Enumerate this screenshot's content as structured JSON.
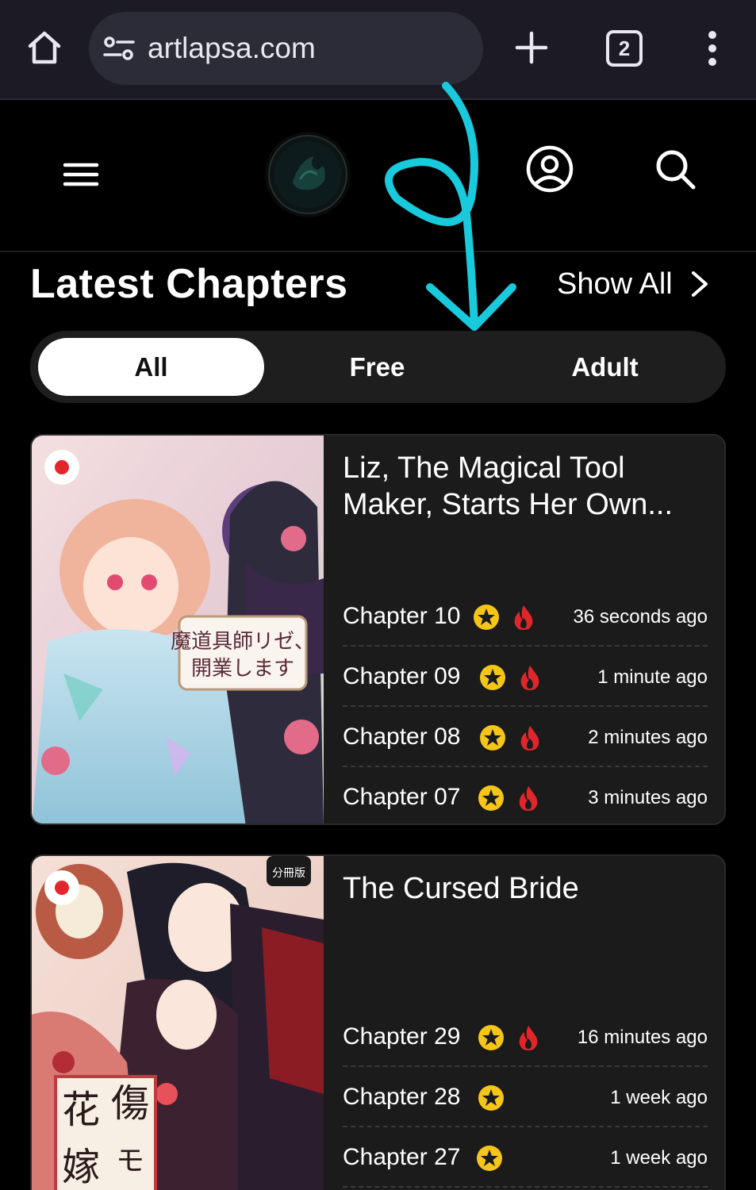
{
  "browser": {
    "url": "artlapsa.com",
    "tab_count": "2"
  },
  "section": {
    "title": "Latest Chapters",
    "show_all_label": "Show All"
  },
  "tabs": [
    {
      "label": "All",
      "active": true
    },
    {
      "label": "Free",
      "active": false
    },
    {
      "label": "Adult",
      "active": false
    }
  ],
  "series": [
    {
      "title": "Liz, The Magical Tool Maker, Starts Her Own...",
      "cover_text": "魔道具師リゼ、開業します",
      "chapters": [
        {
          "label": "Chapter 10",
          "time": "36 seconds ago",
          "premium": true,
          "hot": true
        },
        {
          "label": "Chapter 09",
          "time": "1 minute ago",
          "premium": true,
          "hot": true
        },
        {
          "label": "Chapter 08",
          "time": "2 minutes ago",
          "premium": true,
          "hot": true
        },
        {
          "label": "Chapter 07",
          "time": "3 minutes ago",
          "premium": true,
          "hot": true
        }
      ]
    },
    {
      "title": "The Cursed Bride",
      "cover_text": "傷モノの花嫁",
      "chapters": [
        {
          "label": "Chapter 29",
          "time": "16 minutes ago",
          "premium": true,
          "hot": true
        },
        {
          "label": "Chapter 28",
          "time": "1 week ago",
          "premium": true,
          "hot": false
        },
        {
          "label": "Chapter 27",
          "time": "1 week ago",
          "premium": true,
          "hot": false
        }
      ]
    }
  ],
  "colors": {
    "accent_arrow": "#19c9dc",
    "star": "#f5c518",
    "fire": "#e0262b",
    "card_bg": "#1b1b1b"
  }
}
